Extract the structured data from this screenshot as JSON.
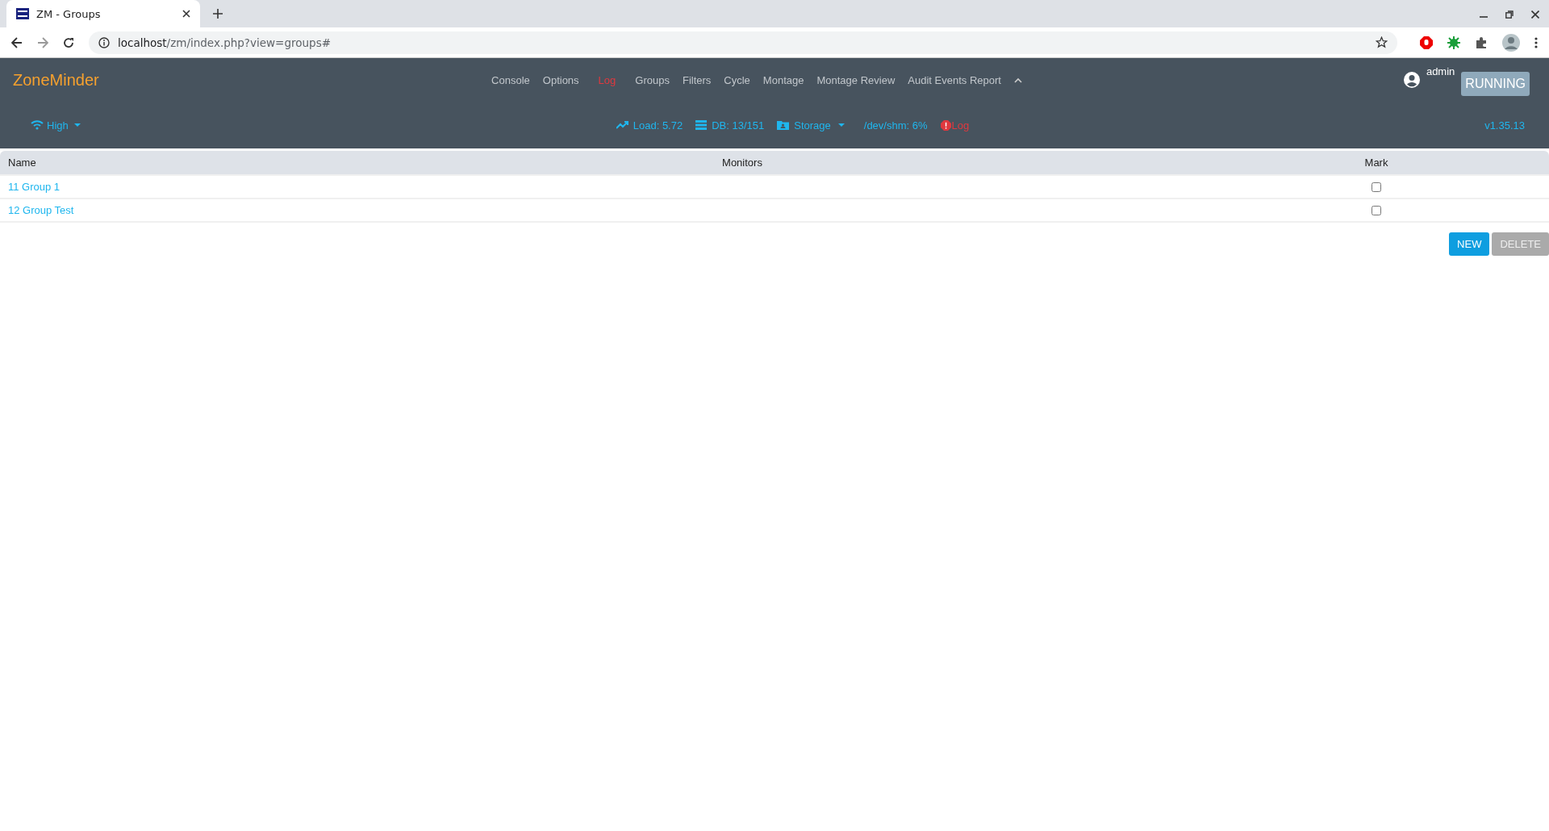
{
  "browser": {
    "tab_title": "ZM - Groups",
    "url_host": "localhost",
    "url_path": "/zm/index.php?view=groups#"
  },
  "header": {
    "brand": "ZoneMinder",
    "nav": [
      {
        "label": "Console",
        "alert": false
      },
      {
        "label": "Options",
        "alert": false
      },
      {
        "label": "Log",
        "alert": true
      },
      {
        "label": "Groups",
        "alert": false
      },
      {
        "label": "Filters",
        "alert": false
      },
      {
        "label": "Cycle",
        "alert": false
      },
      {
        "label": "Montage",
        "alert": false
      },
      {
        "label": "Montage Review",
        "alert": false
      },
      {
        "label": "Audit Events Report",
        "alert": false
      }
    ],
    "user": "admin",
    "status_badge": "RUNNING",
    "bandwidth": "High",
    "stats": [
      {
        "kind": "load",
        "label": "Load: 5.72"
      },
      {
        "kind": "db",
        "label": "DB: 13/151"
      },
      {
        "kind": "storage",
        "label": "Storage"
      },
      {
        "kind": "shm",
        "label": "/dev/shm: 6%"
      },
      {
        "kind": "log",
        "label": "Log"
      }
    ],
    "version": "v1.35.13"
  },
  "table": {
    "columns": [
      "Name",
      "Monitors",
      "Mark"
    ],
    "rows": [
      {
        "name": "11 Group 1",
        "checked": false
      },
      {
        "name": "12 Group Test",
        "checked": false
      }
    ]
  },
  "buttons": [
    {
      "label": "NEW",
      "disabled": false
    },
    {
      "label": "DELETE",
      "disabled": true
    }
  ]
}
